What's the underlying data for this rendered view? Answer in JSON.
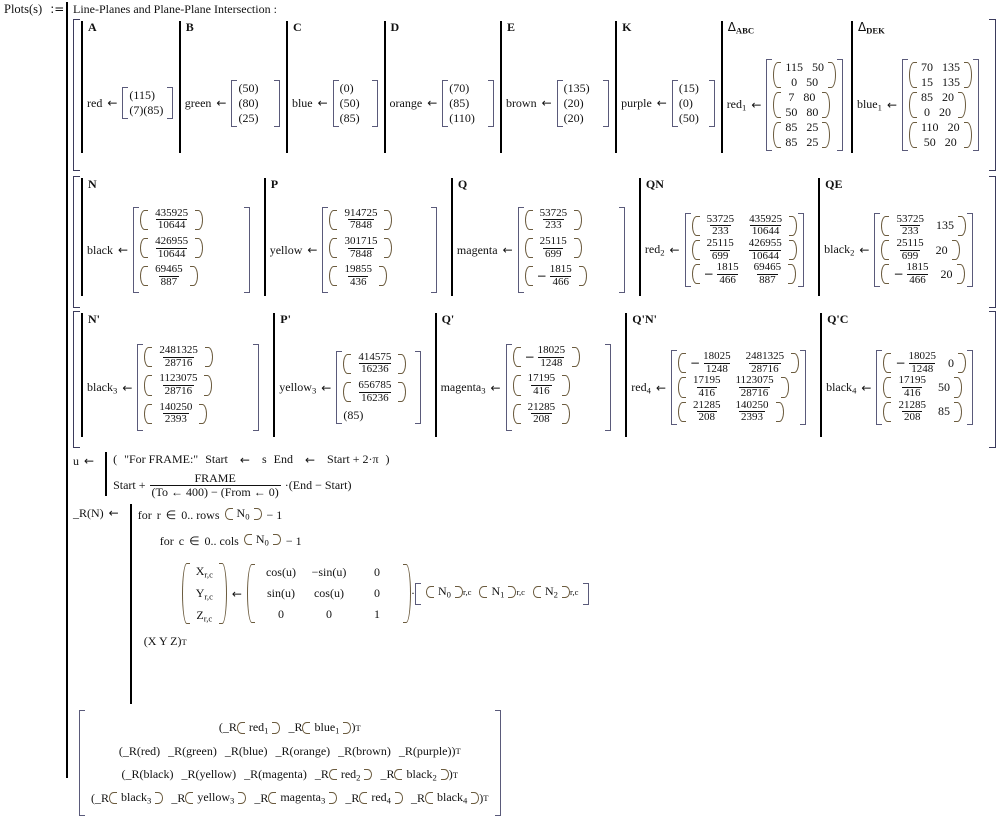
{
  "header": {
    "name": "Plots(s)",
    "assign": ":=",
    "title": "Line-Planes and Plane-Plane Intersection :"
  },
  "row1": {
    "cells": [
      {
        "tag": "A",
        "label": "red",
        "arrow": "←",
        "values": [
          "(115)",
          "(7)",
          "(85)"
        ]
      },
      {
        "tag": "B",
        "label": "green",
        "arrow": "←",
        "values": [
          "(50)",
          "(80)",
          "(25)"
        ]
      },
      {
        "tag": "C",
        "label": "blue",
        "arrow": "←",
        "values": [
          "(0)",
          "(50)",
          "(85)"
        ]
      },
      {
        "tag": "D",
        "label": "orange",
        "arrow": "←",
        "values": [
          "(70)",
          "(85)",
          "(110)"
        ]
      },
      {
        "tag": "E",
        "label": "brown",
        "arrow": "←",
        "values": [
          "(135)",
          "(20)",
          "(20)"
        ]
      },
      {
        "tag": "K",
        "label": "purple",
        "arrow": "←",
        "values": [
          "(15)",
          "(0)",
          "(50)"
        ]
      }
    ],
    "tri_cells": [
      {
        "tag_sym": "Δ",
        "tag_sub": "ABC",
        "label": "red",
        "label_sub": "1",
        "arrow": "←",
        "pairs": [
          [
            "115",
            "50"
          ],
          [
            "0",
            "50"
          ],
          [
            "7",
            "80"
          ],
          [
            "50",
            "80"
          ],
          [
            "85",
            "25"
          ],
          [
            "85",
            "25"
          ]
        ]
      },
      {
        "tag_sym": "Δ",
        "tag_sub": "DEK",
        "label": "blue",
        "label_sub": "1",
        "arrow": "←",
        "pairs": [
          [
            "70",
            "135"
          ],
          [
            "15",
            "135"
          ],
          [
            "85",
            "20"
          ],
          [
            "0",
            "20"
          ],
          [
            "110",
            "20"
          ],
          [
            "50",
            "20"
          ]
        ]
      }
    ]
  },
  "row2": {
    "cells": [
      {
        "tag": "N",
        "label": "black",
        "label_sub": "",
        "arrow": "←",
        "fracs": [
          {
            "n": "435925",
            "d": "10644"
          },
          {
            "n": "426955",
            "d": "10644"
          },
          {
            "n": "69465",
            "d": "887"
          }
        ]
      },
      {
        "tag": "P",
        "label": "yellow",
        "label_sub": "",
        "arrow": "←",
        "fracs": [
          {
            "n": "914725",
            "d": "7848"
          },
          {
            "n": "301715",
            "d": "7848"
          },
          {
            "n": "19855",
            "d": "436"
          }
        ]
      },
      {
        "tag": "Q",
        "label": "magenta",
        "label_sub": "",
        "arrow": "←",
        "fracs": [
          {
            "n": "53725",
            "d": "233"
          },
          {
            "n": "25115",
            "d": "699"
          },
          {
            "n": "1815",
            "d": "466",
            "neg": true
          }
        ]
      },
      {
        "tag": "QN",
        "label": "red",
        "label_sub": "2",
        "arrow": "←",
        "fracs2": [
          [
            {
              "n": "53725",
              "d": "233"
            },
            {
              "n": "435925",
              "d": "10644"
            }
          ],
          [
            {
              "n": "25115",
              "d": "699"
            },
            {
              "n": "426955",
              "d": "10644"
            }
          ],
          [
            {
              "n": "1815",
              "d": "466",
              "neg": true
            },
            {
              "n": "69465",
              "d": "887"
            }
          ]
        ]
      },
      {
        "tag": "QE",
        "label": "black",
        "label_sub": "2",
        "arrow": "←",
        "fracnum": [
          [
            {
              "n": "53725",
              "d": "233"
            },
            "135"
          ],
          [
            {
              "n": "25115",
              "d": "699"
            },
            "20"
          ],
          [
            {
              "n": "1815",
              "d": "466",
              "neg": true
            },
            "20"
          ]
        ]
      }
    ]
  },
  "row3": {
    "cells": [
      {
        "tag": "N'",
        "label": "black",
        "label_sub": "3",
        "arrow": "←",
        "fracs": [
          {
            "n": "2481325",
            "d": "28716"
          },
          {
            "n": "1123075",
            "d": "28716"
          },
          {
            "n": "140250",
            "d": "2393"
          }
        ]
      },
      {
        "tag": "P'",
        "label": "yellow",
        "label_sub": "3",
        "arrow": "←",
        "fracs": [
          {
            "n": "414575",
            "d": "16236"
          },
          {
            "n": "656785",
            "d": "16236"
          },
          {
            "plain": "(85)"
          }
        ]
      },
      {
        "tag": "Q'",
        "label": "magenta",
        "label_sub": "3",
        "arrow": "←",
        "fracs": [
          {
            "n": "18025",
            "d": "1248",
            "neg": true
          },
          {
            "n": "17195",
            "d": "416"
          },
          {
            "n": "21285",
            "d": "208"
          }
        ]
      },
      {
        "tag": "Q'N'",
        "label": "red",
        "label_sub": "4",
        "arrow": "←",
        "fracs2": [
          [
            {
              "n": "18025",
              "d": "1248",
              "neg": true
            },
            {
              "n": "2481325",
              "d": "28716"
            }
          ],
          [
            {
              "n": "17195",
              "d": "416"
            },
            {
              "n": "1123075",
              "d": "28716"
            }
          ],
          [
            {
              "n": "21285",
              "d": "208"
            },
            {
              "n": "140250",
              "d": "2393"
            }
          ]
        ]
      },
      {
        "tag": "Q'C",
        "label": "black",
        "label_sub": "4",
        "arrow": "←",
        "fracnum": [
          [
            {
              "n": "18025",
              "d": "1248",
              "neg": true
            },
            "0"
          ],
          [
            {
              "n": "17195",
              "d": "416"
            },
            "50"
          ],
          [
            {
              "n": "21285",
              "d": "208"
            },
            "85"
          ]
        ]
      }
    ]
  },
  "program": {
    "u_name": "u",
    "u_arrow": "←",
    "line1": {
      "open": "(",
      "frame_text": "\"For FRAME:\"",
      "start_label": "Start",
      "arrow": "←",
      "start_value": "s",
      "end_label": "End",
      "end_expr": "Start + 2·π",
      "close": ")"
    },
    "line2": {
      "prefix": "Start +",
      "numerator": "FRAME",
      "denominator_left": "(To ← 400)",
      "denominator_op": "−",
      "denominator_right": "(From ← 0)",
      "multiplier": "·(End − Start)"
    },
    "func_name": "_R(N)",
    "func_arrow": "←",
    "for_r": {
      "kw": "for",
      "var": "r",
      "in": "∈",
      "range": "0.. rows",
      "arg": "N",
      "arg_sub": "0",
      "tail": "− 1"
    },
    "for_c": {
      "kw": "for",
      "var": "c",
      "in": "∈",
      "range": "0.. cols",
      "arg": "N",
      "arg_sub": "0",
      "tail": "− 1"
    },
    "assign": {
      "lhs": [
        {
          "v": "X",
          "sub": "r,c"
        },
        {
          "v": "Y",
          "sub": "r,c"
        },
        {
          "v": "Z",
          "sub": "r,c"
        }
      ],
      "arrow": "←",
      "matrix": [
        [
          "cos(u)",
          "−sin(u)",
          "0"
        ],
        [
          "sin(u)",
          "cos(u)",
          "0"
        ],
        [
          "0",
          "0",
          "1"
        ]
      ],
      "dot": "·",
      "rhs": [
        {
          "v": "N",
          "sub0": "0",
          "sub": "r,c"
        },
        {
          "v": "N",
          "sub0": "1",
          "sub": "r,c"
        },
        {
          "v": "N",
          "sub0": "2",
          "sub": "r,c"
        }
      ]
    },
    "return_line": {
      "text": "(X  Y  Z)",
      "sup": "T"
    }
  },
  "result": {
    "rows": [
      {
        "open": "(",
        "items": [
          {
            "fn": "_R",
            "arg": "red",
            "arg_sub": "1",
            "round": true
          },
          {
            "fn": "_R",
            "arg": "blue",
            "arg_sub": "1",
            "round": true
          }
        ],
        "close": ")",
        "sup": "T"
      },
      {
        "open": "(",
        "items": [
          {
            "fn": "_R",
            "arg": "red"
          },
          {
            "fn": "_R",
            "arg": "green"
          },
          {
            "fn": "_R",
            "arg": "blue"
          },
          {
            "fn": "_R",
            "arg": "orange"
          },
          {
            "fn": "_R",
            "arg": "brown"
          },
          {
            "fn": "_R",
            "arg": "purple"
          }
        ],
        "close": ")",
        "sup": "T"
      },
      {
        "open": "(",
        "items": [
          {
            "fn": "_R",
            "arg": "black"
          },
          {
            "fn": "_R",
            "arg": "yellow"
          },
          {
            "fn": "_R",
            "arg": "magenta"
          },
          {
            "fn": "_R",
            "arg": "red",
            "arg_sub": "2",
            "round": true
          },
          {
            "fn": "_R",
            "arg": "black",
            "arg_sub": "2",
            "round": true
          }
        ],
        "close": ")",
        "sup": "T"
      },
      {
        "open": "(",
        "items": [
          {
            "fn": "_R",
            "arg": "black",
            "arg_sub": "3",
            "round": true
          },
          {
            "fn": "_R",
            "arg": "yellow",
            "arg_sub": "3",
            "round": true
          },
          {
            "fn": "_R",
            "arg": "magenta",
            "arg_sub": "3",
            "round": true
          },
          {
            "fn": "_R",
            "arg": "red",
            "arg_sub": "4",
            "round": true
          },
          {
            "fn": "_R",
            "arg": "black",
            "arg_sub": "4",
            "round": true
          }
        ],
        "close": ")",
        "sup": "T"
      }
    ]
  },
  "colors": {
    "bracket": "#3b3b5c",
    "paren": "#6b5b3e",
    "text": "#111111"
  }
}
